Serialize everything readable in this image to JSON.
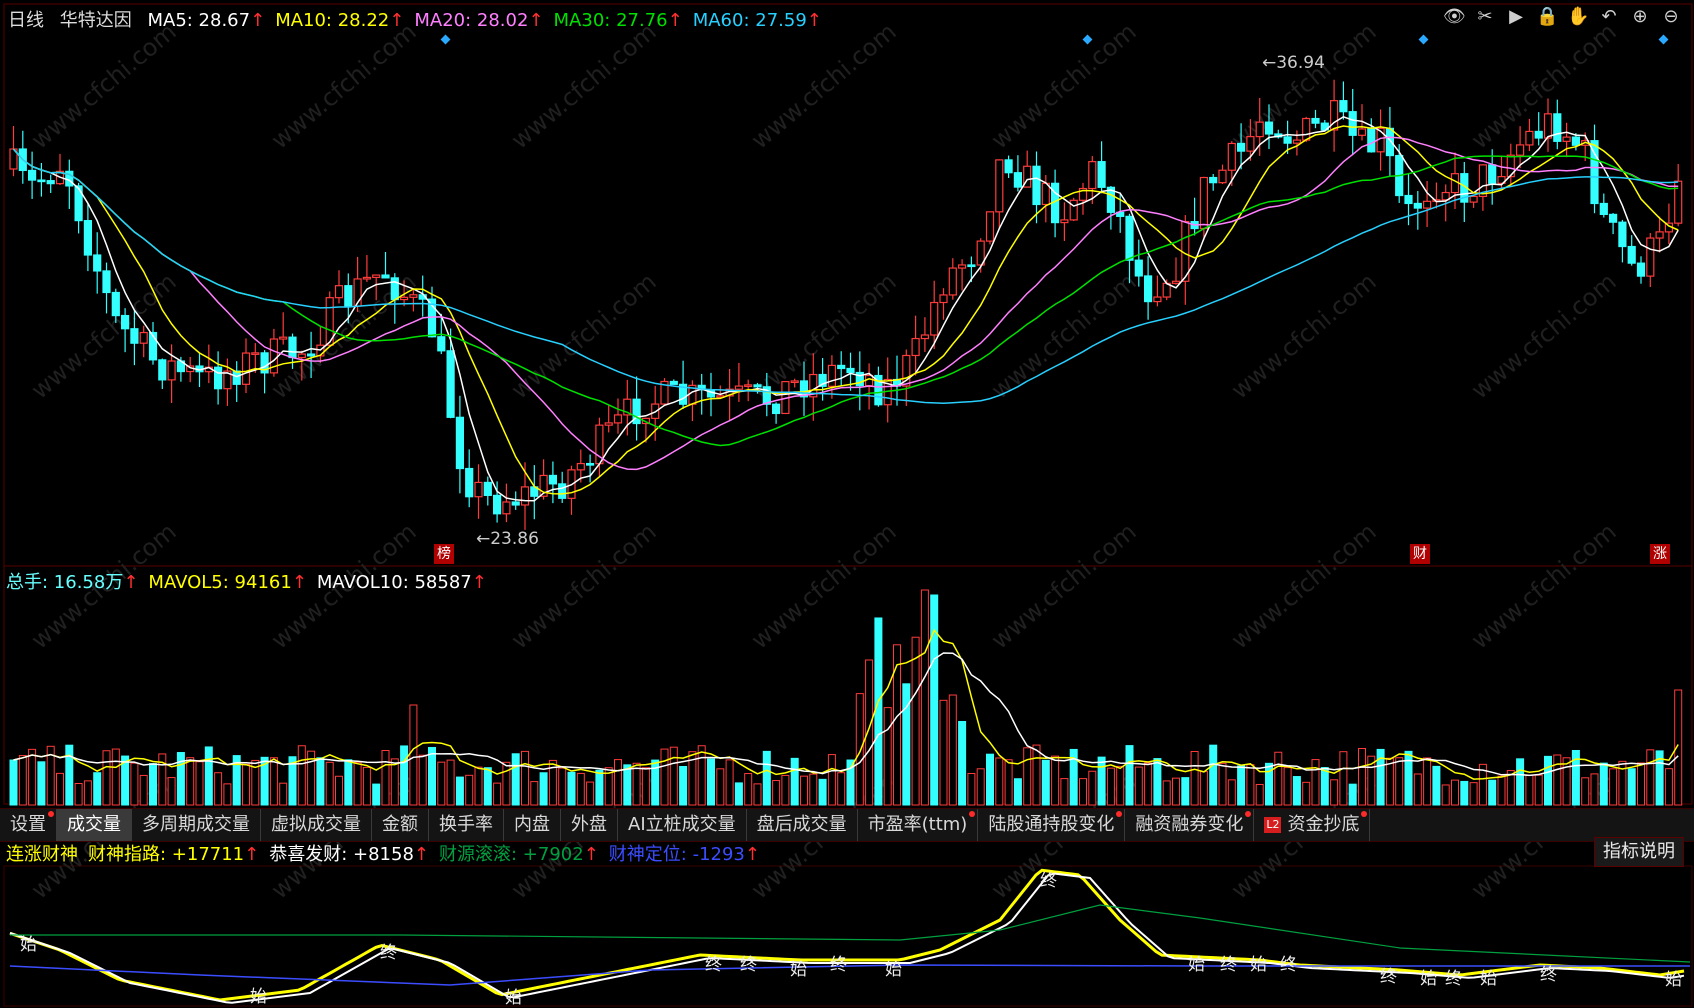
{
  "header": {
    "period": "日线",
    "stock_name": "华特达因",
    "ma": [
      {
        "label": "MA5: 28.67",
        "color": "#ffffff"
      },
      {
        "label": "MA10: 28.22",
        "color": "#ffff00"
      },
      {
        "label": "MA20: 28.02",
        "color": "#ff7fff"
      },
      {
        "label": "MA30: 27.76",
        "color": "#00e000"
      },
      {
        "label": "MA60: 27.59",
        "color": "#27d0ff"
      }
    ],
    "arrow": "↑"
  },
  "price_panel": {
    "high_label": "36.94",
    "low_label": "23.86",
    "events": [
      "榜",
      "财",
      "涨"
    ]
  },
  "volume_panel": {
    "items": [
      {
        "label": "总手: 16.58万",
        "color": "#6ff"
      },
      {
        "label": "MAVOL5: 94161",
        "color": "#ffff00"
      },
      {
        "label": "MAVOL10: 58587",
        "color": "#ffffff"
      }
    ]
  },
  "tabs": [
    {
      "label": "设置",
      "dot": true
    },
    {
      "label": "成交量",
      "active": true
    },
    {
      "label": "多周期成交量"
    },
    {
      "label": "虚拟成交量"
    },
    {
      "label": "金额"
    },
    {
      "label": "换手率"
    },
    {
      "label": "内盘"
    },
    {
      "label": "外盘"
    },
    {
      "label": "AI立桩成交量"
    },
    {
      "label": "盘后成交量"
    },
    {
      "label": "市盈率(ttm)",
      "dot": true
    },
    {
      "label": "陆股通持股变化",
      "dot": true
    },
    {
      "label": "融资融券变化",
      "dot": true
    },
    {
      "label": "资金抄底",
      "dot": true,
      "badge": "L2"
    }
  ],
  "indicator_panel": {
    "items": [
      {
        "label": "连涨财神",
        "color": "#ffff00"
      },
      {
        "label": "财神指路: +17711",
        "color": "#ffff00"
      },
      {
        "label": "恭喜发财: +8158",
        "color": "#ffffff"
      },
      {
        "label": "财源滚滚: +7902",
        "color": "#00a040"
      },
      {
        "label": "财神定位: -1293",
        "color": "#3b4dff"
      }
    ],
    "explain_button": "指标说明",
    "markers": [
      "始",
      "终"
    ]
  },
  "icons": [
    "eye-icon",
    "scissors-icon",
    "play-icon",
    "lock-icon",
    "hand-icon",
    "undo-icon",
    "zoom-in-icon",
    "zoom-out-icon"
  ],
  "watermark": "www.cfchi.com"
}
